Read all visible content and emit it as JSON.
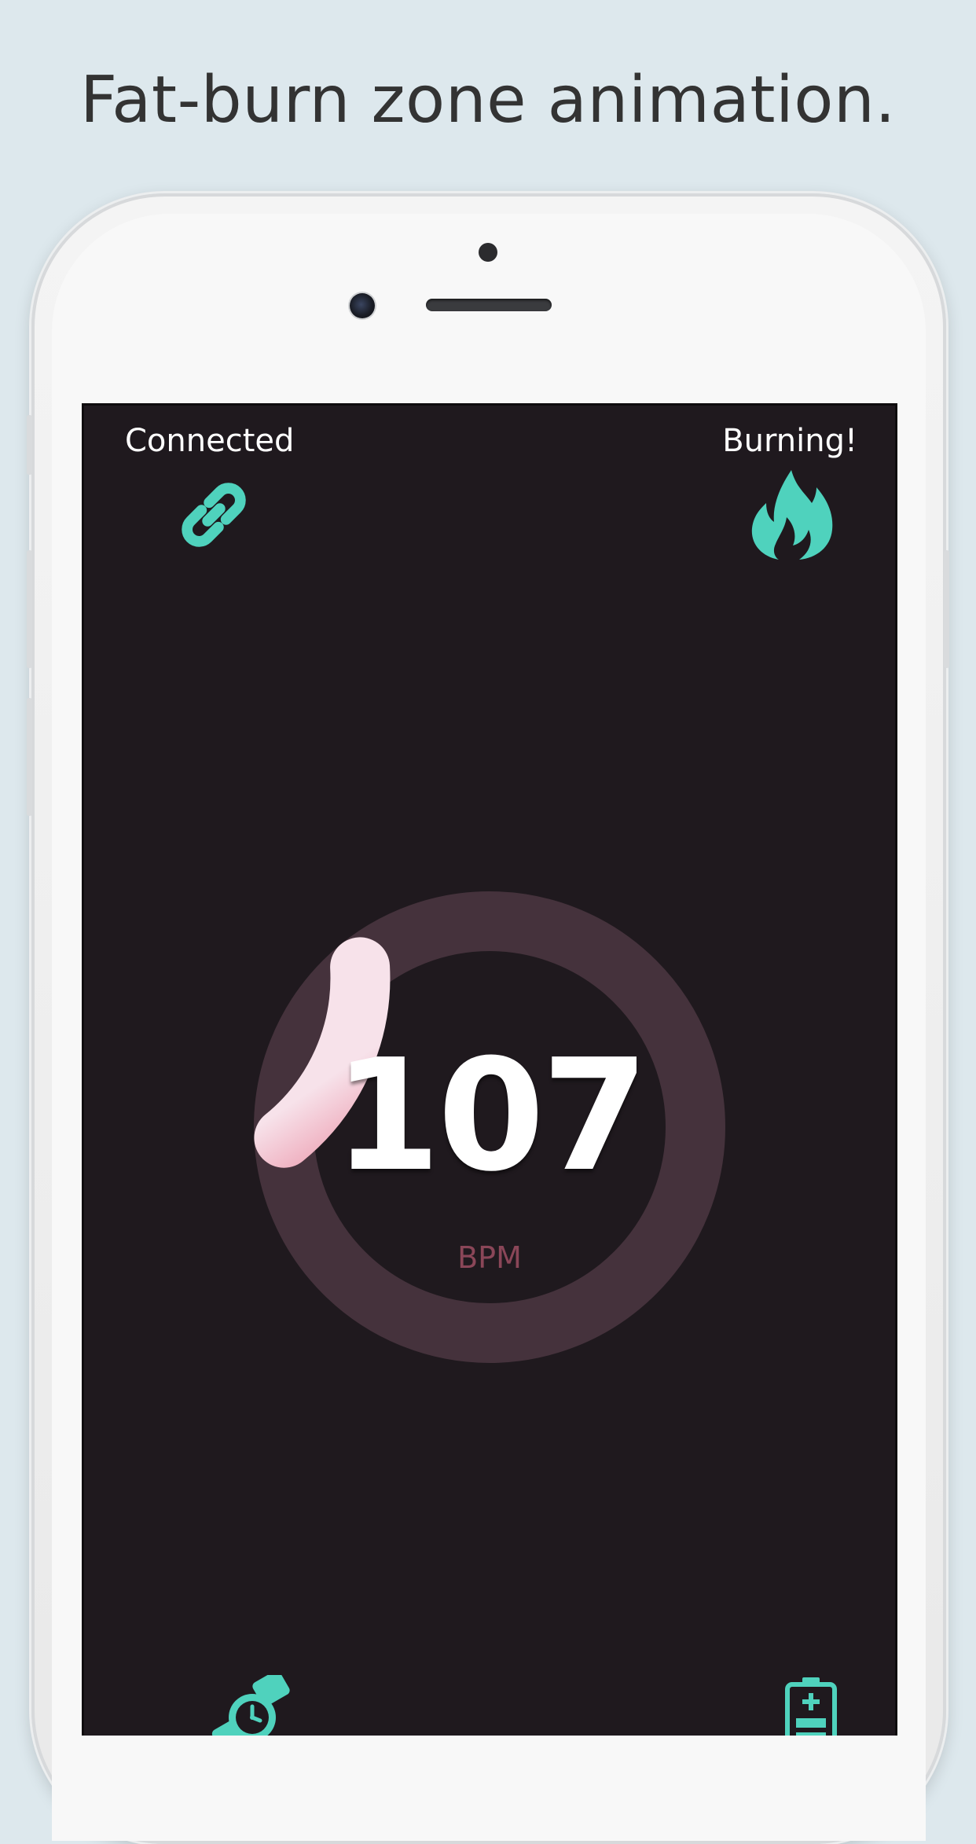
{
  "caption": "Fat-burn zone animation.",
  "status": {
    "connection_label": "Connected",
    "connection_icon": "link-icon",
    "zone_label": "Burning!",
    "zone_icon": "flame-icon"
  },
  "heart_rate": {
    "value": "107",
    "unit": "BPM",
    "gauge_fill_fraction": 0.15
  },
  "footer": {
    "left_icon": "watch-icon",
    "right_icon": "battery-icon"
  },
  "colors": {
    "accent": "#4fd2bd",
    "gauge_track": "#45323c",
    "gauge_fill_start": "#f7e2ea",
    "gauge_fill_end": "#d70015",
    "unit_text": "#8a4658",
    "screen_background": "#1f191e"
  }
}
